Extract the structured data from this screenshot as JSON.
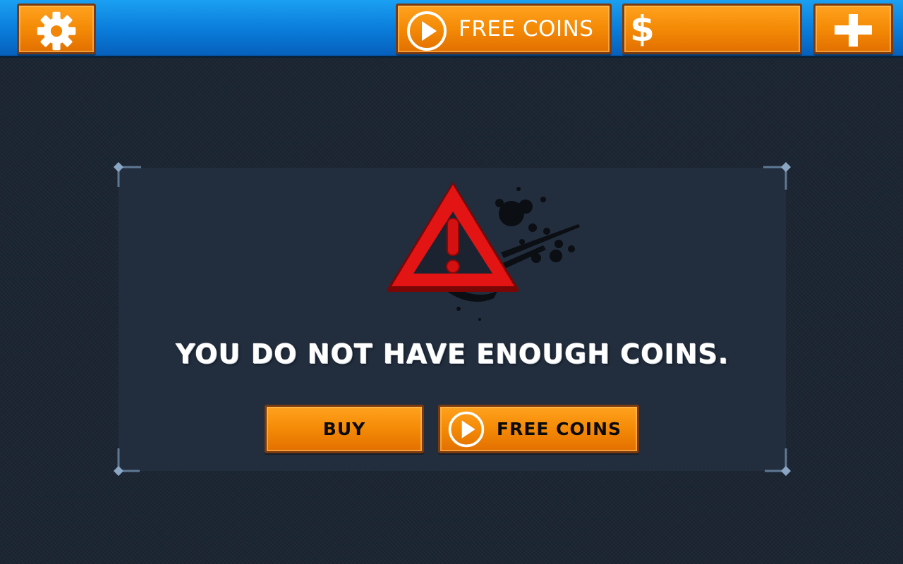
{
  "topbar": {
    "settings": {
      "icon": "gear-icon"
    },
    "free_coins": {
      "icon": "play-circle-icon",
      "label": "FREE COINS"
    },
    "balance": {
      "icon": "dollar-icon",
      "symbol": "$",
      "value": ""
    },
    "add": {
      "icon": "plus-icon"
    }
  },
  "dialog": {
    "icon": "warning-triangle-icon",
    "message": "You do not have enough coins.",
    "buy_label": "Buy",
    "free_label": "Free Coins",
    "free_icon": "play-circle-icon"
  },
  "colors": {
    "topbar_blue": "#0a7bd9",
    "button_orange": "#f48a06",
    "button_border": "#7a3a0d",
    "dialog_bg": "#222d3d",
    "page_bg": "#1c2633",
    "warning_red": "#e01010"
  }
}
